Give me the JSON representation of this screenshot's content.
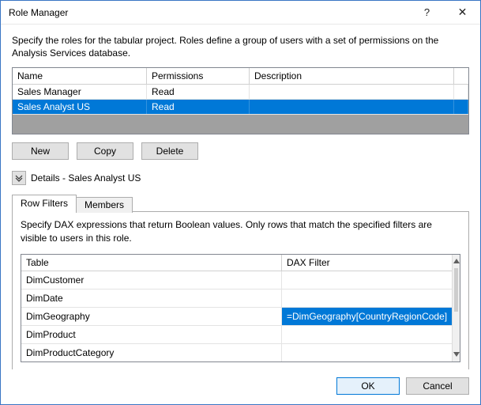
{
  "window": {
    "title": "Role Manager",
    "help_label": "?",
    "close_label": "✕"
  },
  "description": "Specify the roles for the tabular project. Roles define a group of users with a set of permissions on the Analysis Services database.",
  "roles_header": {
    "name": "Name",
    "permissions": "Permissions",
    "description": "Description"
  },
  "roles": [
    {
      "name": "Sales Manager",
      "permissions": "Read",
      "description": "",
      "selected": false
    },
    {
      "name": "Sales Analyst US",
      "permissions": "Read",
      "description": "",
      "selected": true
    }
  ],
  "buttons": {
    "new": "New",
    "copy": "Copy",
    "delete": "Delete",
    "ok": "OK",
    "cancel": "Cancel"
  },
  "details_label": "Details - Sales Analyst US",
  "tabs": {
    "row_filters": "Row Filters",
    "members": "Members",
    "active": "row_filters"
  },
  "filter_desc": "Specify DAX expressions that return Boolean values. Only rows that match the specified filters are visible to users in this role.",
  "filter_header": {
    "table": "Table",
    "dax": "DAX Filter"
  },
  "filter_rows": [
    {
      "table": "DimCustomer",
      "dax": ""
    },
    {
      "table": "DimDate",
      "dax": ""
    },
    {
      "table": "DimGeography",
      "dax": "=DimGeography[CountryRegionCode] = \"US\"",
      "dax_selected": true
    },
    {
      "table": "DimProduct",
      "dax": ""
    },
    {
      "table": "DimProductCategory",
      "dax": ""
    }
  ]
}
